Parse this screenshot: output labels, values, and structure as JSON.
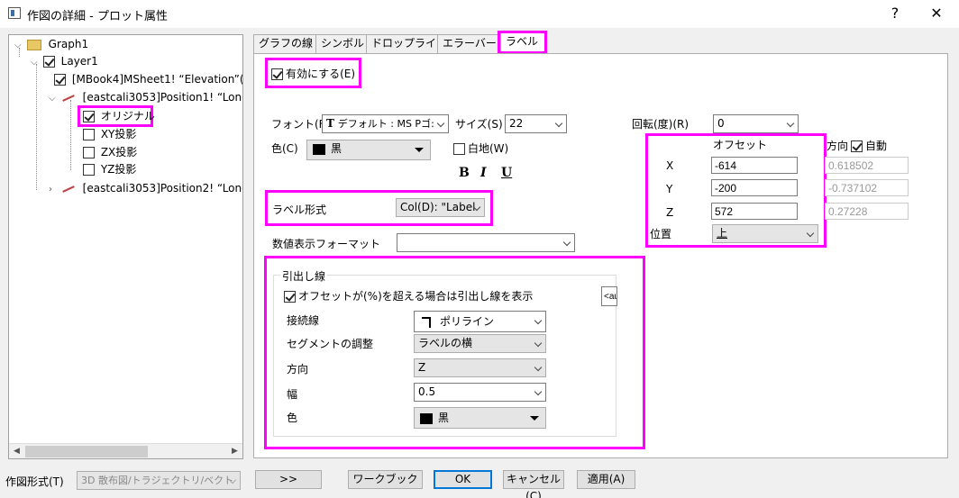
{
  "window": {
    "title": "作図の詳細 - プロット属性",
    "help_label": "?",
    "close_label": "✕"
  },
  "tree": {
    "items": [
      {
        "label": "Graph1"
      },
      {
        "label": "Layer1"
      },
      {
        "label": "[MBook4]MSheet1! “Elevation”(Z)"
      },
      {
        "label": "[eastcali3053]Position1! “Longitud"
      },
      {
        "label": "オリジナル"
      },
      {
        "label": "XY投影"
      },
      {
        "label": "ZX投影"
      },
      {
        "label": "YZ投影"
      },
      {
        "label": "[eastcali3053]Position2! “Longitud"
      }
    ]
  },
  "tabs": [
    "グラフの線",
    "シンボル",
    "ドロップライン",
    "エラーバー",
    "ラベル"
  ],
  "label_tab": {
    "enable_label": "有効にする(E)",
    "font_label": "フォント(F)",
    "font_value": "デフォルト : MS Pゴ:",
    "size_label": "サイズ(S)",
    "size_value": "22",
    "color_label": "色(C)",
    "color_value": "黒",
    "background_label": "白地(W)",
    "bold": "B",
    "italic": "I",
    "underline": "U",
    "rotation_label": "回転(度)(R)",
    "rotation_value": "0",
    "offset_title": "オフセット",
    "direction_label": "方向",
    "auto_label": "自動",
    "x_label": "X",
    "x_value": "-614",
    "x_dir": "0.618502",
    "y_label": "Y",
    "y_value": "-200",
    "y_dir": "-0.737102",
    "z_label": "Z",
    "z_value": "572",
    "z_dir": "0.27228",
    "position_label": "位置",
    "position_value": "上",
    "label_format_label": "ラベル形式",
    "label_format_value": "Col(D): \"Label",
    "number_format_label": "数値表示フォーマット",
    "number_format_value": "",
    "leader": {
      "title": "引出し線",
      "show_leader": "オフセットが(%)を超える場合は引出し線を表示",
      "threshold_value": "<au",
      "connector_label": "接続線",
      "connector_value": "ポリライン",
      "segment_label": "セグメントの調整",
      "segment_value": "ラベルの横",
      "direction_label": "方向",
      "direction_value": "Z",
      "width_label": "幅",
      "width_value": "0.5",
      "color_label": "色",
      "color_value": "黒"
    }
  },
  "footer": {
    "plot_type_label": "作図形式(T)",
    "plot_type_value": "3D 散布図/トラジェクトリ/ベクト",
    "expand_button": ">>",
    "workbook_button": "ワークブック",
    "ok_button": "OK",
    "cancel_button": "キャンセル(C)",
    "apply_button": "適用(A)"
  },
  "colors": {
    "highlight": "#ff00ff",
    "default_button_border": "#0078d7"
  }
}
